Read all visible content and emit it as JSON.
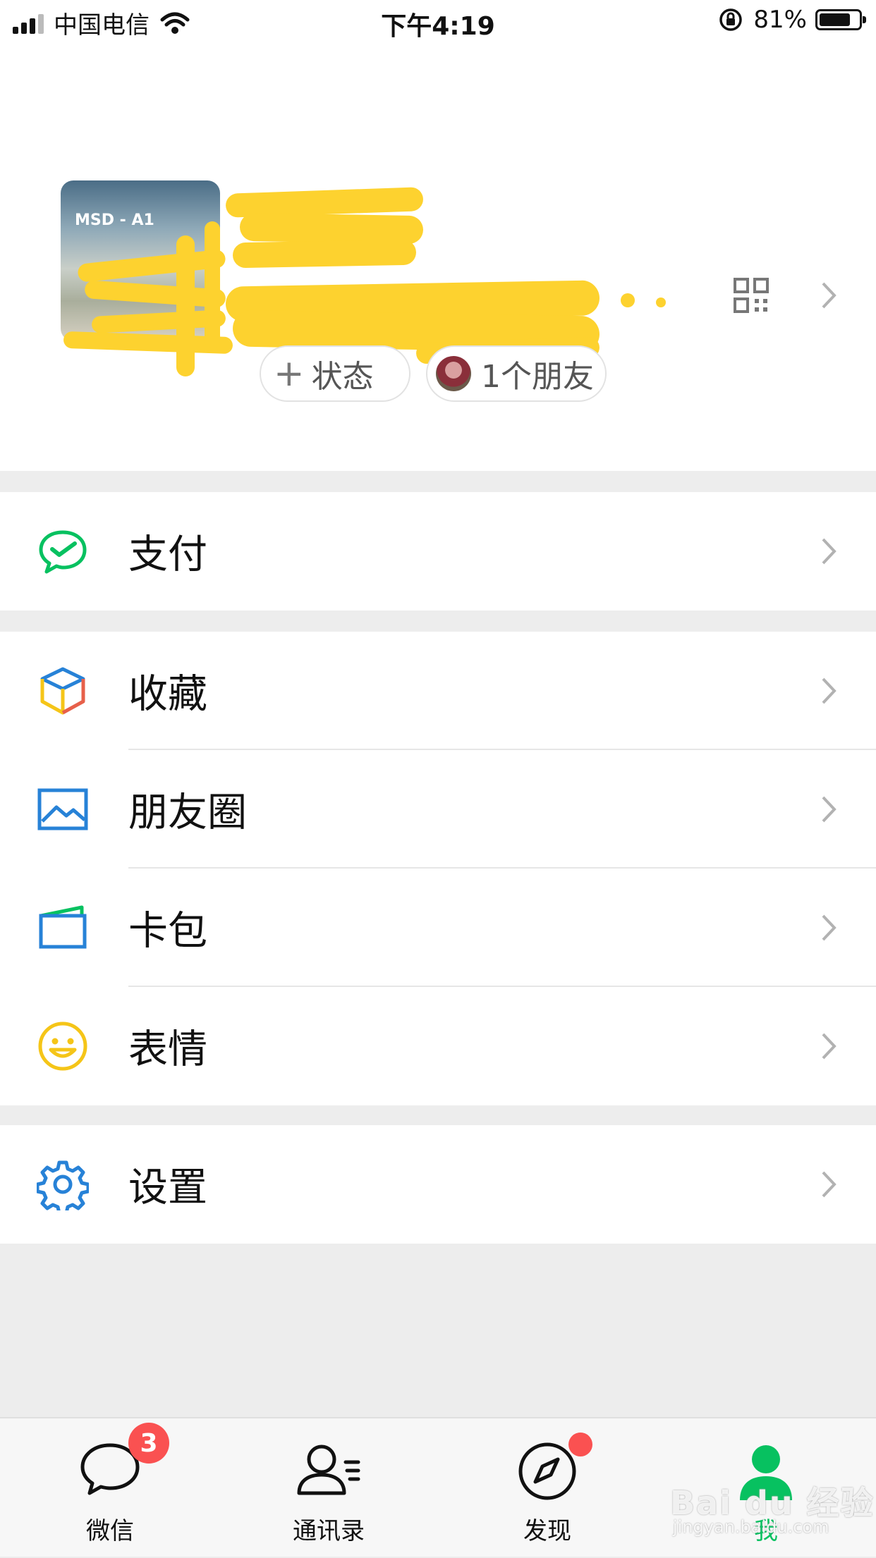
{
  "status_bar": {
    "carrier": "中国电信",
    "time": "下午4:19",
    "battery_percent": "81%",
    "battery_level": 0.81
  },
  "profile": {
    "avatar_text": "MSD - A1",
    "status_chip_label": "状态",
    "friends_chip_label": "1个朋友",
    "qr_icon": "qr-code-icon"
  },
  "menu": {
    "pay": {
      "label": "支付",
      "icon": "wechat-pay-icon",
      "color": "#07c160"
    },
    "favorites": {
      "label": "收藏",
      "icon": "cube-icon",
      "color": "#e7604a"
    },
    "moments": {
      "label": "朋友圈",
      "icon": "picture-icon",
      "color": "#2782d7"
    },
    "cards": {
      "label": "卡包",
      "icon": "wallet-icon",
      "color": "#2782d7"
    },
    "stickers": {
      "label": "表情",
      "icon": "smile-icon",
      "color": "#f5c518"
    },
    "settings": {
      "label": "设置",
      "icon": "gear-icon",
      "color": "#2782d7"
    }
  },
  "tabbar": {
    "tabs": [
      {
        "label": "微信",
        "icon": "chat-bubble-icon",
        "badge": "3"
      },
      {
        "label": "通讯录",
        "icon": "contacts-icon"
      },
      {
        "label": "发现",
        "icon": "compass-icon",
        "dot": true
      },
      {
        "label": "我",
        "icon": "person-icon",
        "active": true
      }
    ],
    "active_color": "#07c160"
  },
  "watermark": {
    "main": "Bai du 经验",
    "sub": "jingyan.baidu.com"
  }
}
